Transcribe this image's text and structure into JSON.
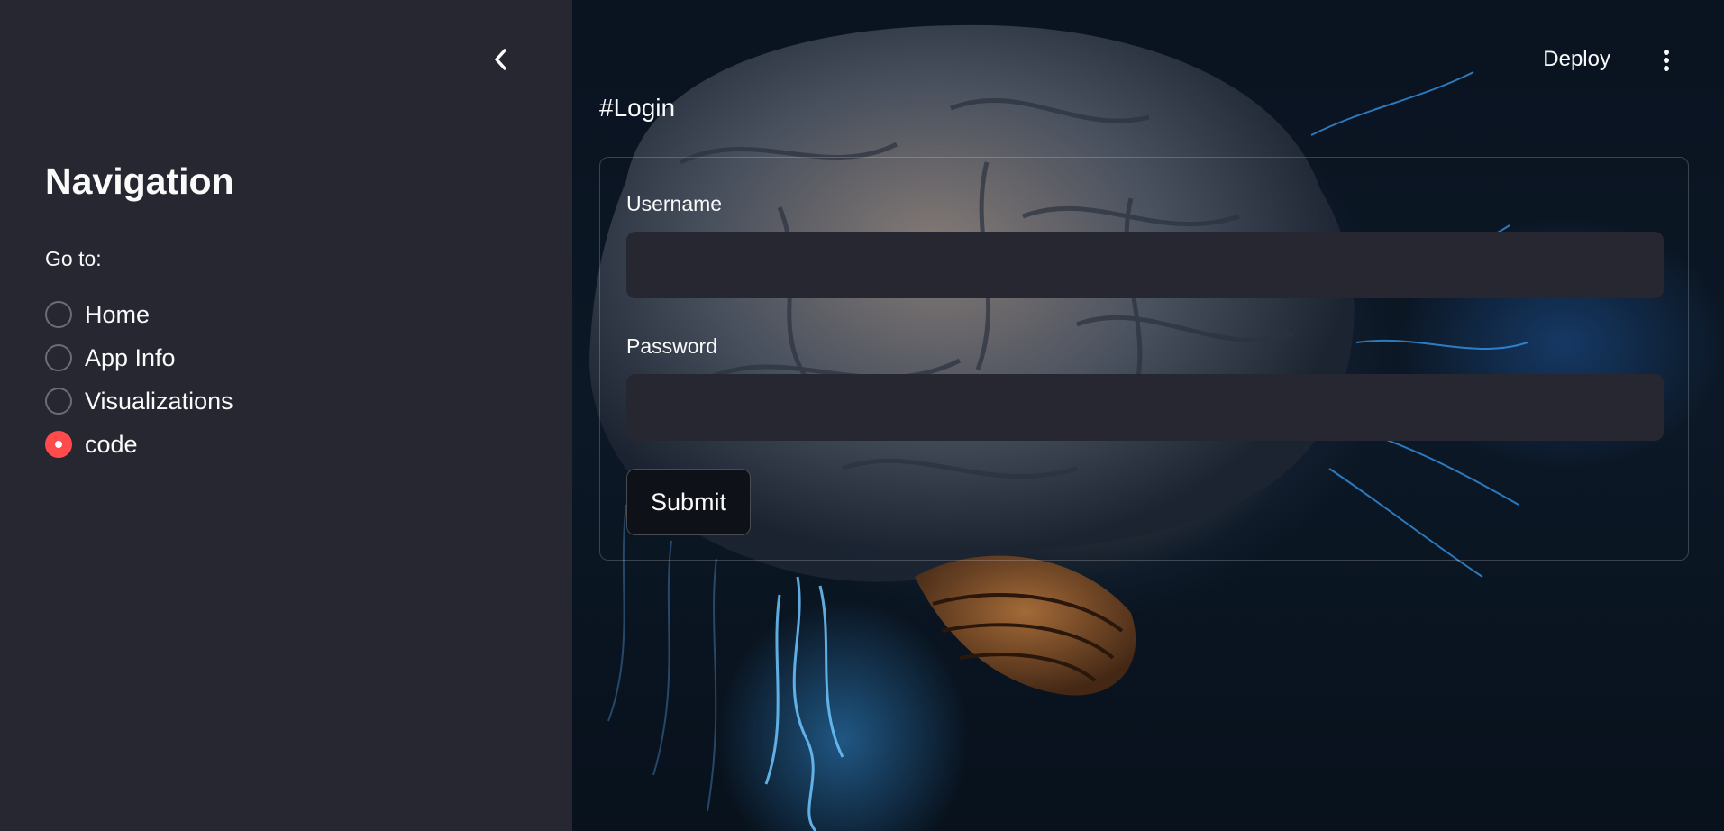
{
  "sidebar": {
    "title": "Navigation",
    "radio_label": "Go to:",
    "options": [
      {
        "label": "Home",
        "selected": false
      },
      {
        "label": "App Info",
        "selected": false
      },
      {
        "label": "Visualizations",
        "selected": false
      },
      {
        "label": "code",
        "selected": true
      }
    ]
  },
  "toolbar": {
    "deploy_label": "Deploy"
  },
  "main": {
    "heading": "#Login",
    "form": {
      "username_label": "Username",
      "username_value": "",
      "password_label": "Password",
      "password_value": "",
      "submit_label": "Submit"
    }
  },
  "colors": {
    "sidebar_bg": "#262730",
    "accent": "#ff4b4b",
    "input_bg": "#262730",
    "text": "#fafafa"
  },
  "icons": {
    "collapse": "chevron-left-icon",
    "menu": "vertical-dots-icon",
    "background": "brain-image"
  }
}
